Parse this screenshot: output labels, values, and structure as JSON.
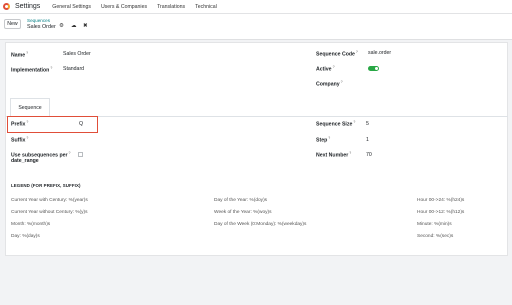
{
  "navbar": {
    "app_title": "Settings",
    "items": [
      "General Settings",
      "Users & Companies",
      "Translations",
      "Technical"
    ]
  },
  "control": {
    "new_label": "New",
    "breadcrumb_parent": "Sequences",
    "breadcrumb_current": "Sales Order",
    "icons": [
      "gear-icon",
      "cloud-upload-icon",
      "discard-icon"
    ]
  },
  "form": {
    "name": {
      "label": "Name",
      "help": "?",
      "value": "Sales Order"
    },
    "implementation": {
      "label": "Implementation",
      "help": "?",
      "value": "Standard"
    },
    "sequence_code": {
      "label": "Sequence Code",
      "help": "?",
      "value": "sale.order"
    },
    "active": {
      "label": "Active",
      "help": "?",
      "value": true
    },
    "company": {
      "label": "Company",
      "help": "?",
      "value": ""
    }
  },
  "tabs": [
    {
      "label": "Sequence",
      "active": true
    }
  ],
  "sequence_tab": {
    "prefix": {
      "label": "Prefix",
      "help": "?",
      "value": "Q"
    },
    "suffix": {
      "label": "Suffix",
      "help": "?",
      "value": ""
    },
    "use_subsequences": {
      "label_line1": "Use subsequences per",
      "label_line2": "date_range",
      "help": "?",
      "checked": false
    },
    "sequence_size": {
      "label": "Sequence Size",
      "help": "?",
      "value": "5"
    },
    "step": {
      "label": "Step",
      "help": "?",
      "value": "1"
    },
    "next_number": {
      "label": "Next Number",
      "help": "?",
      "value": "70"
    }
  },
  "legend": {
    "title": "LEGEND (FOR PREFIX, SUFFIX)",
    "col1": [
      "Current Year with Century: %(year)s",
      "Current Year without Century: %(y)s",
      "Month: %(month)s",
      "Day: %(day)s"
    ],
    "col2": [
      "Day of the Year: %(doy)s",
      "Week of the Year: %(woy)s",
      "Day of the Week (0:Monday): %(weekday)s"
    ],
    "col3": [
      "Hour 00->24: %(h24)s",
      "Hour 00->12: %(h12)s",
      "Minute: %(min)s",
      "Second: %(sec)s"
    ]
  },
  "colors": {
    "accent": "#017e84",
    "toggle_on": "#28a745",
    "highlight_box": "#e04e39"
  }
}
